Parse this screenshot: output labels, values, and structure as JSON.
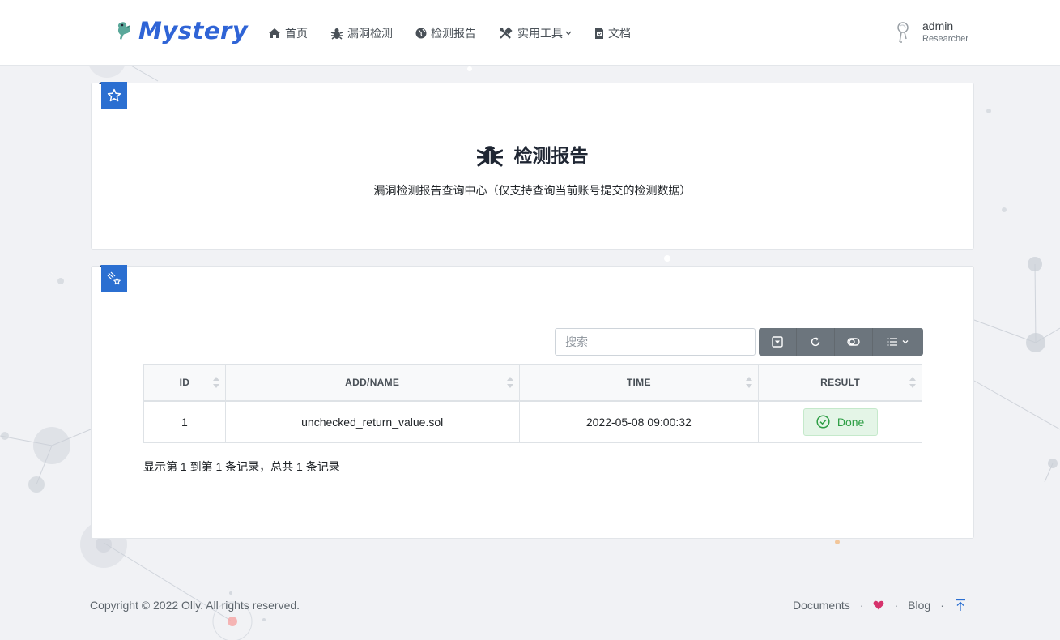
{
  "brand": {
    "name": "Mystery",
    "color": "#2f64d6"
  },
  "nav": {
    "items": [
      {
        "label": "首页",
        "icon": "home-icon"
      },
      {
        "label": "漏洞检测",
        "icon": "bug-icon"
      },
      {
        "label": "检测报告",
        "icon": "globe-icon"
      },
      {
        "label": "实用工具",
        "icon": "tools-icon",
        "dropdown": true
      },
      {
        "label": "文档",
        "icon": "file-icon"
      }
    ]
  },
  "user": {
    "name": "admin",
    "role": "Researcher"
  },
  "header_card": {
    "title": "检测报告",
    "subtitle": "漏洞检测报告查询中心（仅支持查询当前账号提交的检测数据）"
  },
  "table_card": {
    "search": {
      "placeholder": "搜索",
      "value": ""
    },
    "toolbar": [
      "export-icon",
      "refresh-icon",
      "toggle-icon",
      "columns-icon"
    ],
    "columns": [
      "ID",
      "ADD/NAME",
      "TIME",
      "RESULT"
    ],
    "rows": [
      {
        "id": "1",
        "name": "unchecked_return_value.sol",
        "time": "2022-05-08 09:00:32",
        "result": "Done"
      }
    ],
    "info": "显示第 1 到第 1 条记录，总共 1 条记录"
  },
  "footer": {
    "copyright": "Copyright © 2022 Olly. All rights reserved.",
    "links": [
      "Documents",
      "Blog"
    ]
  },
  "colors": {
    "accent": "#2b6fd1",
    "success": "#2e9e45",
    "toolbar": "#6c757d",
    "heart": "#d6336c"
  }
}
